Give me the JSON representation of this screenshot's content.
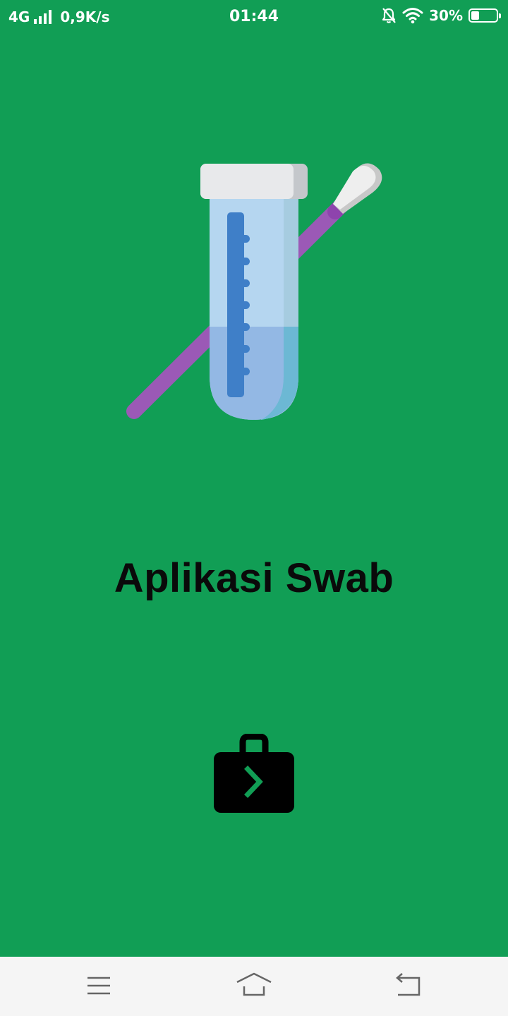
{
  "status_bar": {
    "network": "4G",
    "speed": "0,9K/s",
    "time": "01:44",
    "battery_percent_label": "30%",
    "battery_level": 0.3
  },
  "app": {
    "title": "Aplikasi Swab",
    "background_color": "#119e55"
  },
  "icons": {
    "hero": "swab-test-tube-icon",
    "enter": "briefcase-enter-icon"
  },
  "nav_bar": {
    "items": [
      "menu",
      "home",
      "back"
    ]
  }
}
